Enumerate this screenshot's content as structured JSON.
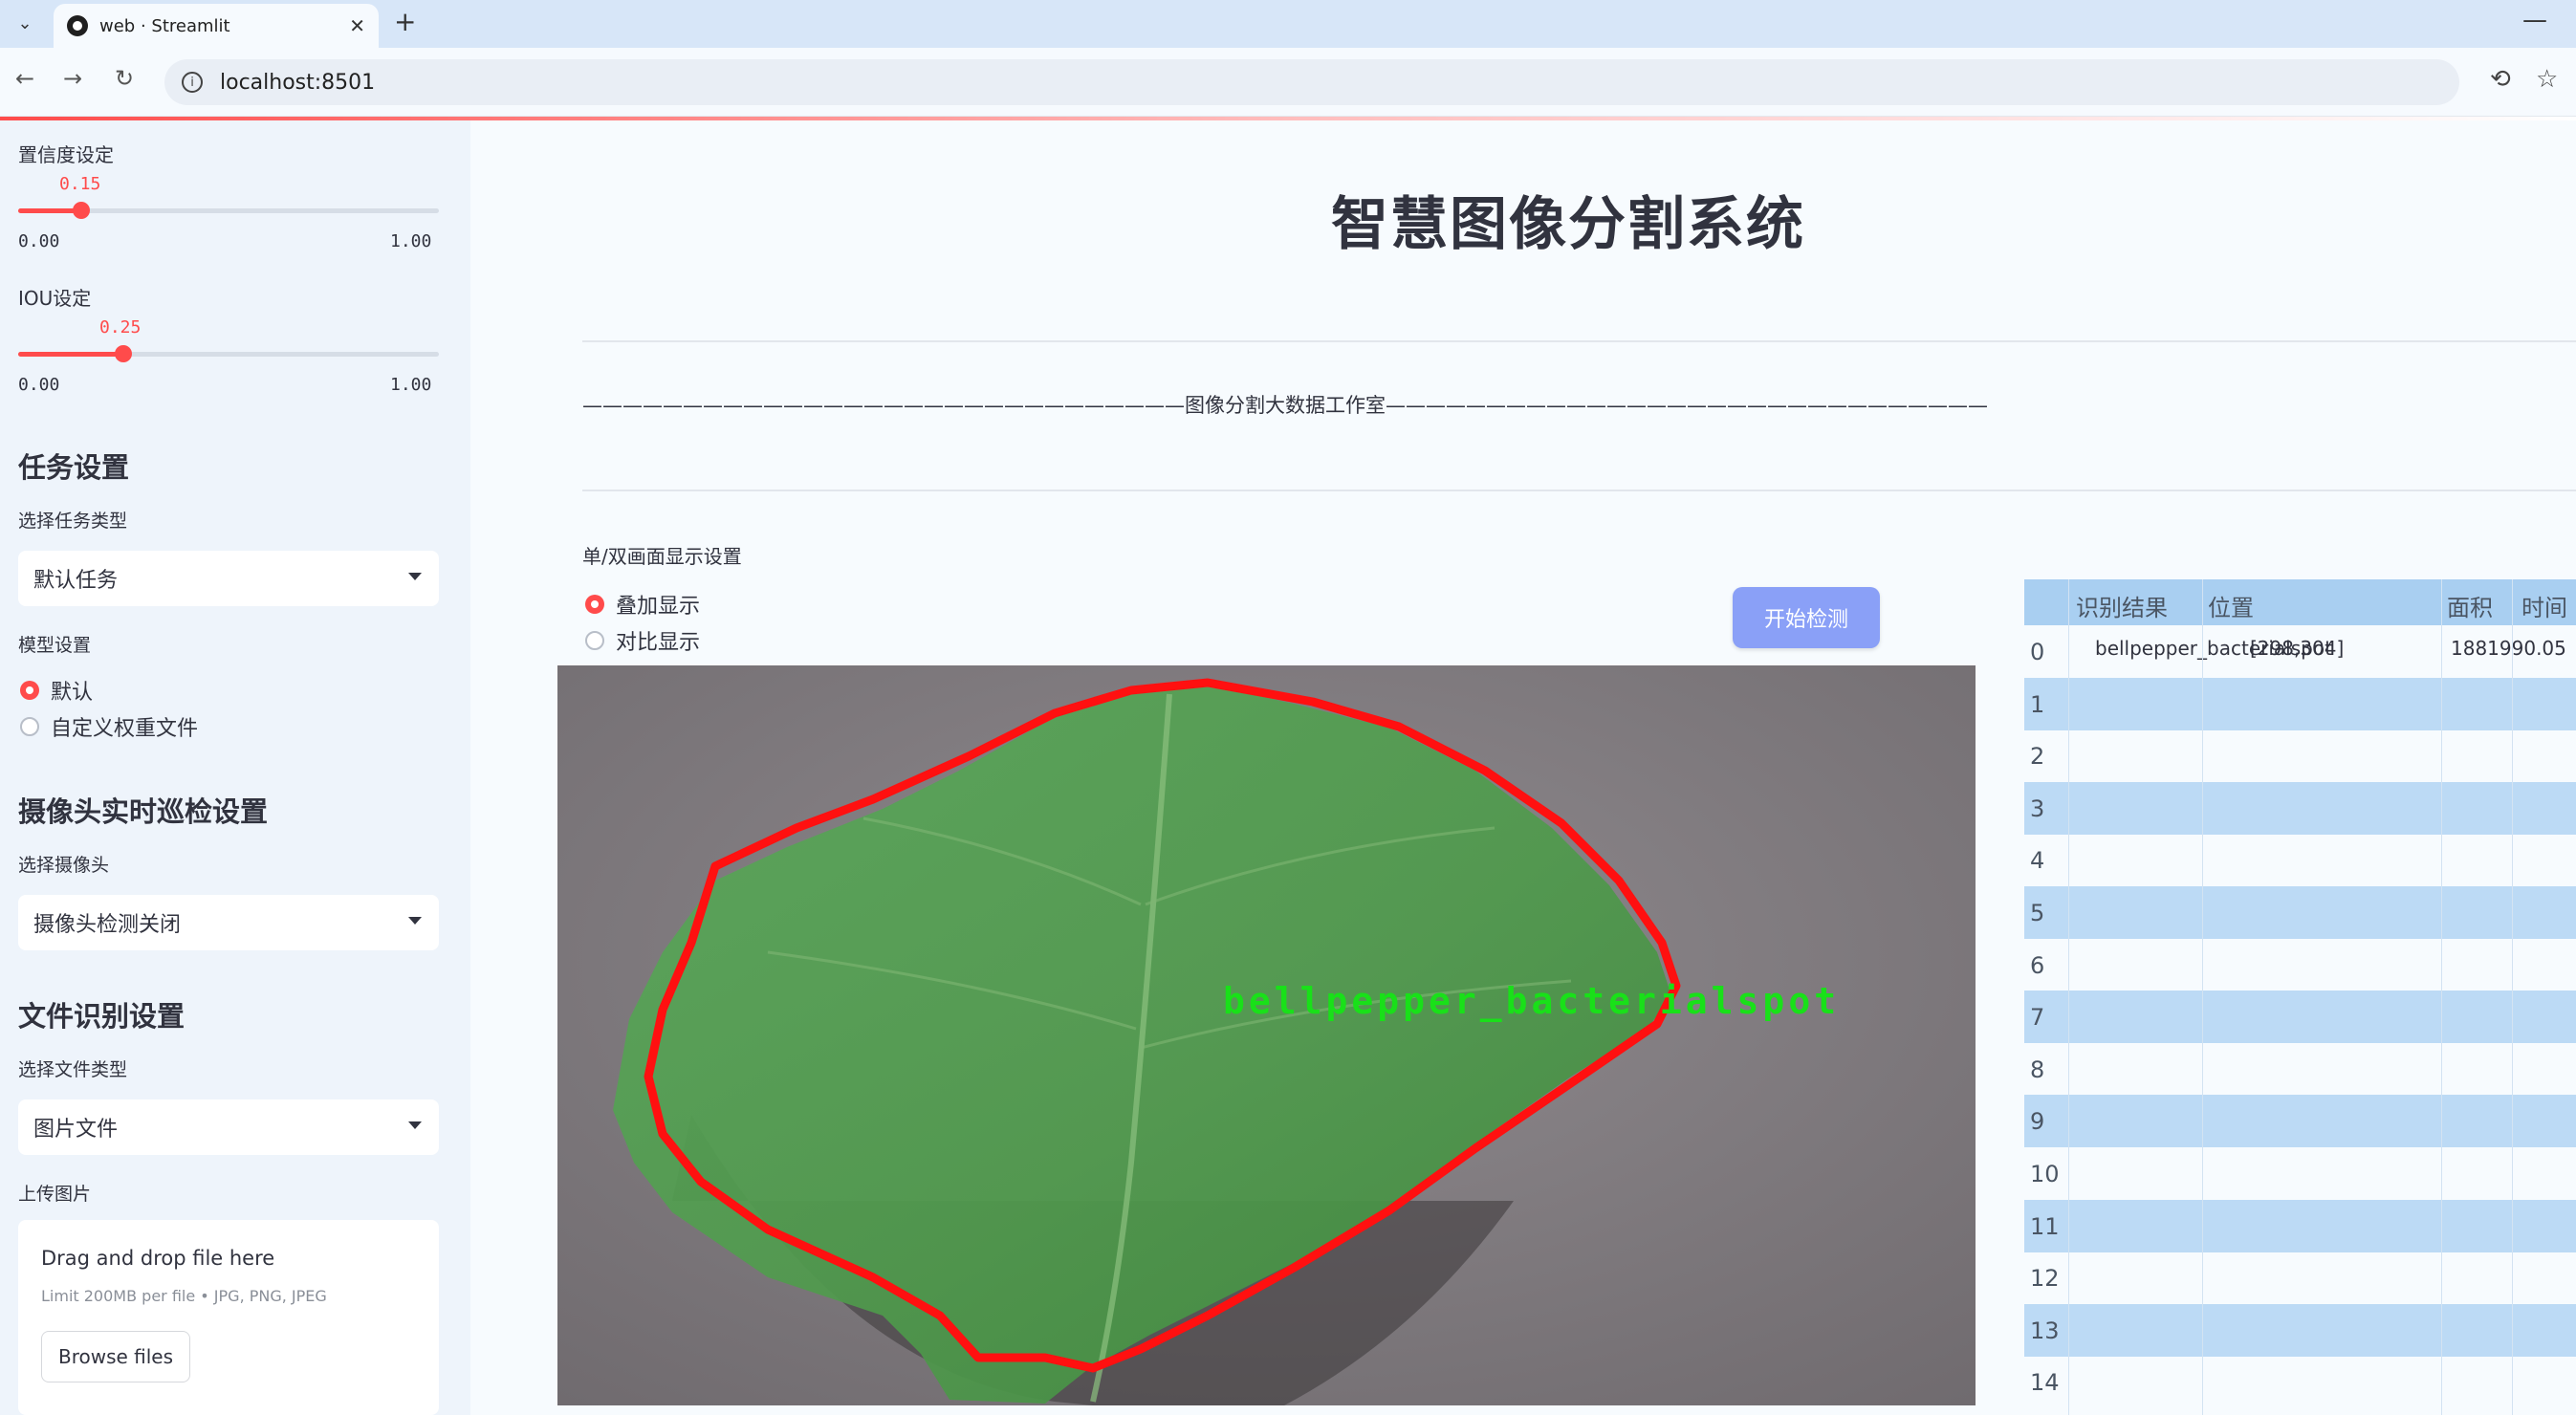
{
  "browser": {
    "tab_title": "web · Streamlit",
    "url": "localhost:8501"
  },
  "sidebar": {
    "confidence": {
      "label": "置信度设定",
      "value": "0.15",
      "fraction": 0.15,
      "min": "0.00",
      "max": "1.00"
    },
    "iou": {
      "label": "IOU设定",
      "value": "0.25",
      "fraction": 0.25,
      "min": "0.00",
      "max": "1.00"
    },
    "task_heading": "任务设置",
    "task_type_label": "选择任务类型",
    "task_type_value": "默认任务",
    "model_label": "模型设置",
    "model_options": [
      "默认",
      "自定义权重文件"
    ],
    "camera_heading": "摄像头实时巡检设置",
    "camera_label": "选择摄像头",
    "camera_value": "摄像头检测关闭",
    "file_heading": "文件识别设置",
    "file_type_label": "选择文件类型",
    "file_type_value": "图片文件",
    "upload_label": "上传图片",
    "upload_title": "Drag and drop file here",
    "upload_limit": "Limit 200MB per file • JPG, PNG, JPEG",
    "browse_label": "Browse files"
  },
  "main": {
    "title": "智慧图像分割系统",
    "divider_text": "——————————————————————————————图像分割大数据工作室——————————————————————————————",
    "mode_label": "单/双画面显示设置",
    "mode_options": [
      "叠加显示",
      "对比显示"
    ],
    "start_button": "开始检测",
    "detection_label": "bellpepper_bacterialspot"
  },
  "table": {
    "headers": [
      "识别结果",
      "位置",
      "面积",
      "时间"
    ],
    "rows": [
      {
        "idx": "0",
        "result": "bellpepper_bacterialspot",
        "position": "[298,304]",
        "area": "1881990.05"
      },
      {
        "idx": "1"
      },
      {
        "idx": "2"
      },
      {
        "idx": "3"
      },
      {
        "idx": "4"
      },
      {
        "idx": "5"
      },
      {
        "idx": "6"
      },
      {
        "idx": "7"
      },
      {
        "idx": "8"
      },
      {
        "idx": "9"
      },
      {
        "idx": "10"
      },
      {
        "idx": "11"
      },
      {
        "idx": "12"
      },
      {
        "idx": "13"
      },
      {
        "idx": "14"
      }
    ]
  },
  "colors": {
    "accent": "#ff4b4b",
    "button": "#8aa0f7",
    "table_header": "#a9cff1",
    "table_alt_row": "#bcdaf5",
    "mask_outline": "#ff0000",
    "label_text": "#19e019"
  }
}
